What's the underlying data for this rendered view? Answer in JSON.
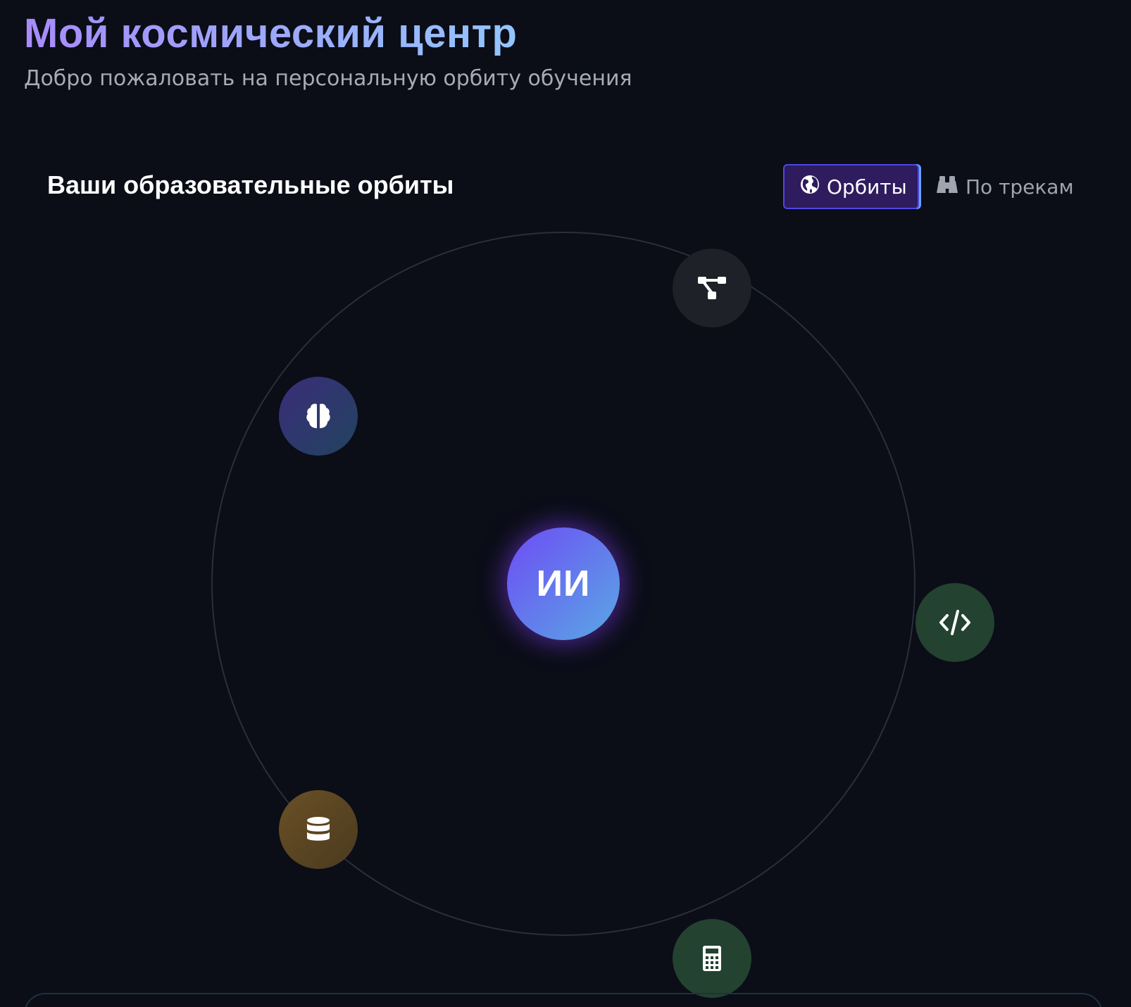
{
  "header": {
    "title": "Мой космический центр",
    "subtitle": "Добро пожаловать на персональную орбиту обучения"
  },
  "section": {
    "title": "Ваши образовательные орбиты"
  },
  "view_toggle": {
    "orbits_label": "Орбиты",
    "orbits_icon": "globe-icon",
    "tracks_label": "По трекам",
    "tracks_icon": "binoculars-icon",
    "active": "orbits"
  },
  "orbit": {
    "core_label": "ИИ",
    "core_gradient": [
      "#6d4cf5",
      "#5aa8e4"
    ],
    "planets": [
      {
        "id": "algorithms",
        "icon": "sitemap-icon",
        "color": "#1f2129"
      },
      {
        "id": "neural",
        "icon": "brain-icon",
        "color": "#2f2f6b"
      },
      {
        "id": "programming",
        "icon": "code-icon",
        "color": "#234230"
      },
      {
        "id": "databases",
        "icon": "database-icon",
        "color": "#5a4422"
      },
      {
        "id": "math",
        "icon": "calculator-icon",
        "color": "#234230"
      }
    ]
  },
  "colors": {
    "background": "#0b0d17",
    "title_gradient_start": "#a78bfa",
    "title_gradient_end": "#93c5fd",
    "accent": "#4f46e5",
    "orbit_line": "#2a2f3c"
  }
}
